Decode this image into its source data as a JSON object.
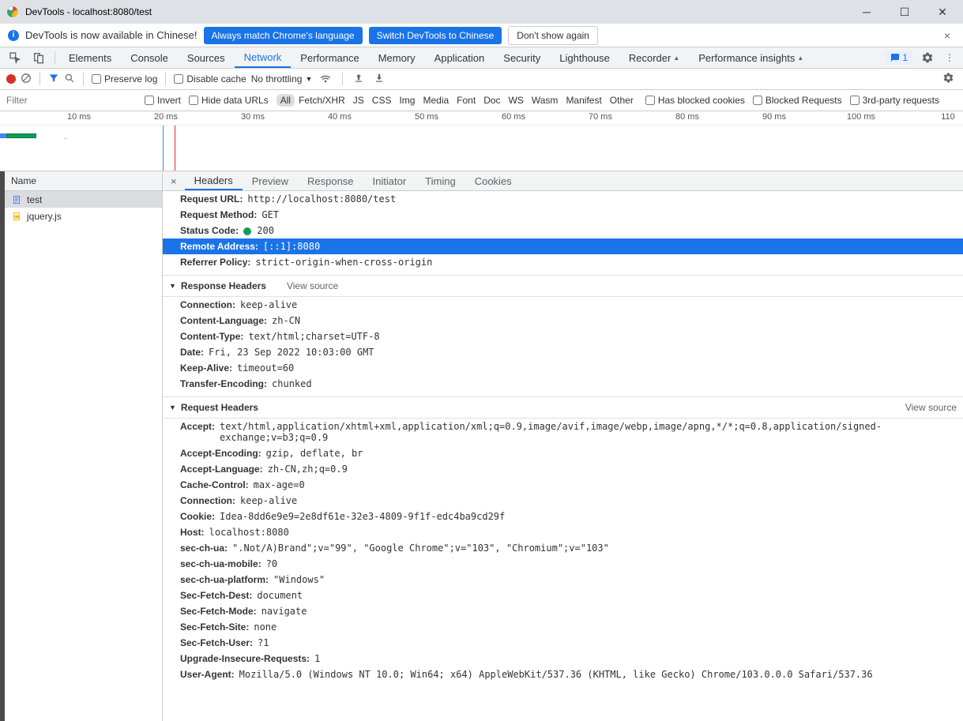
{
  "window": {
    "title": "DevTools - localhost:8080/test"
  },
  "infobar": {
    "message": "DevTools is now available in Chinese!",
    "always_match": "Always match Chrome's language",
    "switch_to": "Switch DevTools to Chinese",
    "dont_show": "Don't show again"
  },
  "main_tabs": {
    "items": [
      "Elements",
      "Console",
      "Sources",
      "Network",
      "Performance",
      "Memory",
      "Application",
      "Security",
      "Lighthouse",
      "Recorder",
      "Performance insights"
    ],
    "active": "Network",
    "issues_count": "1"
  },
  "network_toolbar": {
    "preserve_log": "Preserve log",
    "disable_cache": "Disable cache",
    "throttling": "No throttling"
  },
  "filter_bar": {
    "placeholder": "Filter",
    "invert": "Invert",
    "hide_data_urls": "Hide data URLs",
    "types": [
      "All",
      "Fetch/XHR",
      "JS",
      "CSS",
      "Img",
      "Media",
      "Font",
      "Doc",
      "WS",
      "Wasm",
      "Manifest",
      "Other"
    ],
    "active_type": "All",
    "has_blocked_cookies": "Has blocked cookies",
    "blocked_requests": "Blocked Requests",
    "third_party": "3rd-party requests"
  },
  "timeline": {
    "ticks": [
      "10 ms",
      "20 ms",
      "30 ms",
      "40 ms",
      "50 ms",
      "60 ms",
      "70 ms",
      "80 ms",
      "90 ms",
      "100 ms",
      "110"
    ]
  },
  "requests": {
    "header": "Name",
    "items": [
      {
        "name": "test",
        "icon": "doc"
      },
      {
        "name": "jquery.js",
        "icon": "js"
      }
    ],
    "selected": "test"
  },
  "detail_tabs": {
    "items": [
      "Headers",
      "Preview",
      "Response",
      "Initiator",
      "Timing",
      "Cookies"
    ],
    "active": "Headers"
  },
  "general": [
    {
      "key": "Request URL:",
      "val": "http://localhost:8080/test"
    },
    {
      "key": "Request Method:",
      "val": "GET"
    },
    {
      "key": "Status Code:",
      "val": "200",
      "status_dot": true
    },
    {
      "key": "Remote Address:",
      "val": "[::1]:8080",
      "selected": true
    },
    {
      "key": "Referrer Policy:",
      "val": "strict-origin-when-cross-origin"
    }
  ],
  "response_headers": {
    "title": "Response Headers",
    "view_source": "View source",
    "items": [
      {
        "key": "Connection:",
        "val": "keep-alive"
      },
      {
        "key": "Content-Language:",
        "val": "zh-CN"
      },
      {
        "key": "Content-Type:",
        "val": "text/html;charset=UTF-8"
      },
      {
        "key": "Date:",
        "val": "Fri, 23 Sep 2022 10:03:00 GMT"
      },
      {
        "key": "Keep-Alive:",
        "val": "timeout=60"
      },
      {
        "key": "Transfer-Encoding:",
        "val": "chunked"
      }
    ]
  },
  "request_headers": {
    "title": "Request Headers",
    "view_source": "View source",
    "items": [
      {
        "key": "Accept:",
        "val": "text/html,application/xhtml+xml,application/xml;q=0.9,image/avif,image/webp,image/apng,*/*;q=0.8,application/signed-exchange;v=b3;q=0.9"
      },
      {
        "key": "Accept-Encoding:",
        "val": "gzip, deflate, br"
      },
      {
        "key": "Accept-Language:",
        "val": "zh-CN,zh;q=0.9"
      },
      {
        "key": "Cache-Control:",
        "val": "max-age=0"
      },
      {
        "key": "Connection:",
        "val": "keep-alive"
      },
      {
        "key": "Cookie:",
        "val": "Idea-8dd6e9e9=2e8df61e-32e3-4809-9f1f-edc4ba9cd29f"
      },
      {
        "key": "Host:",
        "val": "localhost:8080"
      },
      {
        "key": "sec-ch-ua:",
        "val": "\".Not/A)Brand\";v=\"99\", \"Google Chrome\";v=\"103\", \"Chromium\";v=\"103\""
      },
      {
        "key": "sec-ch-ua-mobile:",
        "val": "?0"
      },
      {
        "key": "sec-ch-ua-platform:",
        "val": "\"Windows\""
      },
      {
        "key": "Sec-Fetch-Dest:",
        "val": "document"
      },
      {
        "key": "Sec-Fetch-Mode:",
        "val": "navigate"
      },
      {
        "key": "Sec-Fetch-Site:",
        "val": "none"
      },
      {
        "key": "Sec-Fetch-User:",
        "val": "?1"
      },
      {
        "key": "Upgrade-Insecure-Requests:",
        "val": "1"
      },
      {
        "key": "User-Agent:",
        "val": "Mozilla/5.0 (Windows NT 10.0; Win64; x64) AppleWebKit/537.36 (KHTML, like Gecko) Chrome/103.0.0.0 Safari/537.36"
      }
    ]
  }
}
